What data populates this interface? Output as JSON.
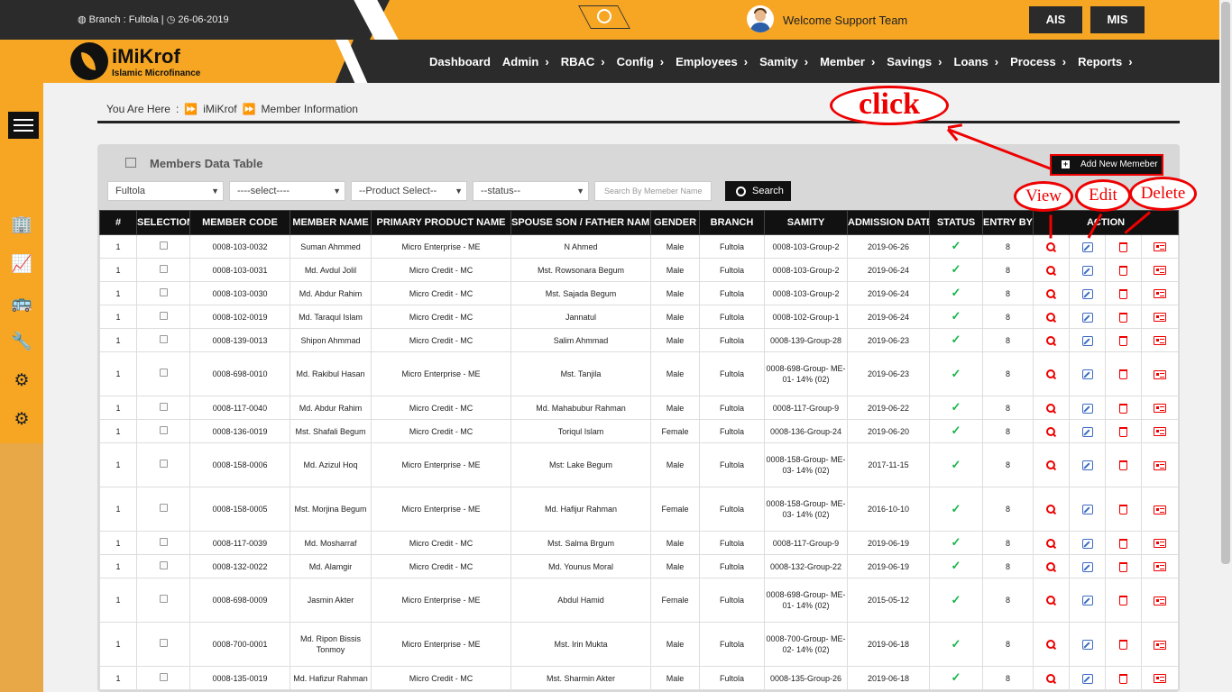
{
  "topbar": {
    "branch_text": "Branch : Fultola |",
    "date": "26-06-2019",
    "welcome": "Welcome Support Team",
    "buttons": [
      "AIS",
      "MIS"
    ]
  },
  "brand": {
    "name": "iMiKrof",
    "tagline": "Islamic Microfinance"
  },
  "nav": [
    "Dashboard",
    "Admin",
    "RBAC",
    "Config",
    "Employees",
    "Samity",
    "Member",
    "Savings",
    "Loans",
    "Process",
    "Reports"
  ],
  "nav_chevron": "›",
  "breadcrumb": {
    "lead": "You Are Here",
    "sep": ":",
    "arrow": "⏩",
    "items": [
      "iMiKrof",
      "Member Information"
    ]
  },
  "annotations": {
    "click": "click",
    "view": "View",
    "edit": "Edit",
    "delete": "Delete"
  },
  "panel": {
    "title": "Members Data Table",
    "add_button": "Add New Memeber"
  },
  "filters": {
    "branch": "Fultola",
    "samity": "----select----",
    "product": "--Product Select--",
    "status": "--status--",
    "search_placeholder": "Search By Memeber Name",
    "search_button": "Search"
  },
  "table": {
    "headers": [
      "#",
      "SELECTION",
      "MEMBER CODE",
      "MEMBER NAME",
      "PRIMARY PRODUCT NAME",
      "SPOUSE SON / FATHER NAME",
      "GENDER",
      "BRANCH",
      "SAMITY",
      "ADMISSION DATE",
      "STATUS",
      "ENTRY BY",
      "ACTION"
    ],
    "rows": [
      {
        "n": "1",
        "code": "0008-103-0032",
        "name": "Suman Ahmmed",
        "product": "Micro Enterprise - ME",
        "spouse": "N Ahmed",
        "gender": "Male",
        "branch": "Fultola",
        "samity": "0008-103-Group-2",
        "date": "2019-06-26",
        "entry": "8"
      },
      {
        "n": "1",
        "code": "0008-103-0031",
        "name": "Md. Avdul Jolil",
        "product": "Micro Credit - MC",
        "spouse": "Mst. Rowsonara Begum",
        "gender": "Male",
        "branch": "Fultola",
        "samity": "0008-103-Group-2",
        "date": "2019-06-24",
        "entry": "8"
      },
      {
        "n": "1",
        "code": "0008-103-0030",
        "name": "Md. Abdur Rahim",
        "product": "Micro Credit - MC",
        "spouse": "Mst. Sajada Begum",
        "gender": "Male",
        "branch": "Fultola",
        "samity": "0008-103-Group-2",
        "date": "2019-06-24",
        "entry": "8"
      },
      {
        "n": "1",
        "code": "0008-102-0019",
        "name": "Md. Taraqul Islam",
        "product": "Micro Credit - MC",
        "spouse": "Jannatul",
        "gender": "Male",
        "branch": "Fultola",
        "samity": "0008-102-Group-1",
        "date": "2019-06-24",
        "entry": "8"
      },
      {
        "n": "1",
        "code": "0008-139-0013",
        "name": "Shipon Ahmmad",
        "product": "Micro Credit - MC",
        "spouse": "Salim Ahmmad",
        "gender": "Male",
        "branch": "Fultola",
        "samity": "0008-139-Group-28",
        "date": "2019-06-23",
        "entry": "8"
      },
      {
        "n": "1",
        "code": "0008-698-0010",
        "name": "Md. Rakibul Hasan",
        "product": "Micro Enterprise - ME",
        "spouse": "Mst. Tanjila",
        "gender": "Male",
        "branch": "Fultola",
        "samity": "0008-698-Group- ME-01- 14% (02)",
        "date": "2019-06-23",
        "entry": "8"
      },
      {
        "n": "1",
        "code": "0008-117-0040",
        "name": "Md. Abdur Rahim",
        "product": "Micro Credit - MC",
        "spouse": "Md. Mahabubur Rahman",
        "gender": "Male",
        "branch": "Fultola",
        "samity": "0008-117-Group-9",
        "date": "2019-06-22",
        "entry": "8"
      },
      {
        "n": "1",
        "code": "0008-136-0019",
        "name": "Mst. Shafali Begum",
        "product": "Micro Credit - MC",
        "spouse": "Toriqul Islam",
        "gender": "Female",
        "branch": "Fultola",
        "samity": "0008-136-Group-24",
        "date": "2019-06-20",
        "entry": "8"
      },
      {
        "n": "1",
        "code": "0008-158-0006",
        "name": "Md. Azizul Hoq",
        "product": "Micro Enterprise - ME",
        "spouse": "Mst: Lake Begum",
        "gender": "Male",
        "branch": "Fultola",
        "samity": "0008-158-Group- ME-03- 14% (02)",
        "date": "2017-11-15",
        "entry": "8"
      },
      {
        "n": "1",
        "code": "0008-158-0005",
        "name": "Mst. Morjina Begum",
        "product": "Micro Enterprise - ME",
        "spouse": "Md. Hafijur Rahman",
        "gender": "Female",
        "branch": "Fultola",
        "samity": "0008-158-Group- ME-03- 14% (02)",
        "date": "2016-10-10",
        "entry": "8"
      },
      {
        "n": "1",
        "code": "0008-117-0039",
        "name": "Md. Mosharraf",
        "product": "Micro Credit - MC",
        "spouse": "Mst. Salma Brgum",
        "gender": "Male",
        "branch": "Fultola",
        "samity": "0008-117-Group-9",
        "date": "2019-06-19",
        "entry": "8"
      },
      {
        "n": "1",
        "code": "0008-132-0022",
        "name": "Md. Alamgir",
        "product": "Micro Credit - MC",
        "spouse": "Md. Younus Moral",
        "gender": "Male",
        "branch": "Fultola",
        "samity": "0008-132-Group-22",
        "date": "2019-06-19",
        "entry": "8"
      },
      {
        "n": "1",
        "code": "0008-698-0009",
        "name": "Jasmin Akter",
        "product": "Micro Enterprise - ME",
        "spouse": "Abdul Hamid",
        "gender": "Female",
        "branch": "Fultola",
        "samity": "0008-698-Group- ME-01- 14% (02)",
        "date": "2015-05-12",
        "entry": "8"
      },
      {
        "n": "1",
        "code": "0008-700-0001",
        "name": "Md. Ripon Bissis Tonmoy",
        "product": "Micro Enterprise - ME",
        "spouse": "Mst. Irin Mukta",
        "gender": "Male",
        "branch": "Fultola",
        "samity": "0008-700-Group- ME-02- 14% (02)",
        "date": "2019-06-18",
        "entry": "8"
      },
      {
        "n": "1",
        "code": "0008-135-0019",
        "name": "Md. Hafizur Rahman",
        "product": "Micro Credit - MC",
        "spouse": "Mst. Sharmin Akter",
        "gender": "Male",
        "branch": "Fultola",
        "samity": "0008-135-Group-26",
        "date": "2019-06-18",
        "entry": "8"
      }
    ]
  },
  "colors": {
    "accent": "#f6a623",
    "dark": "#2b2b2b",
    "annotation": "#e00000",
    "status_ok": "#18b54a"
  }
}
